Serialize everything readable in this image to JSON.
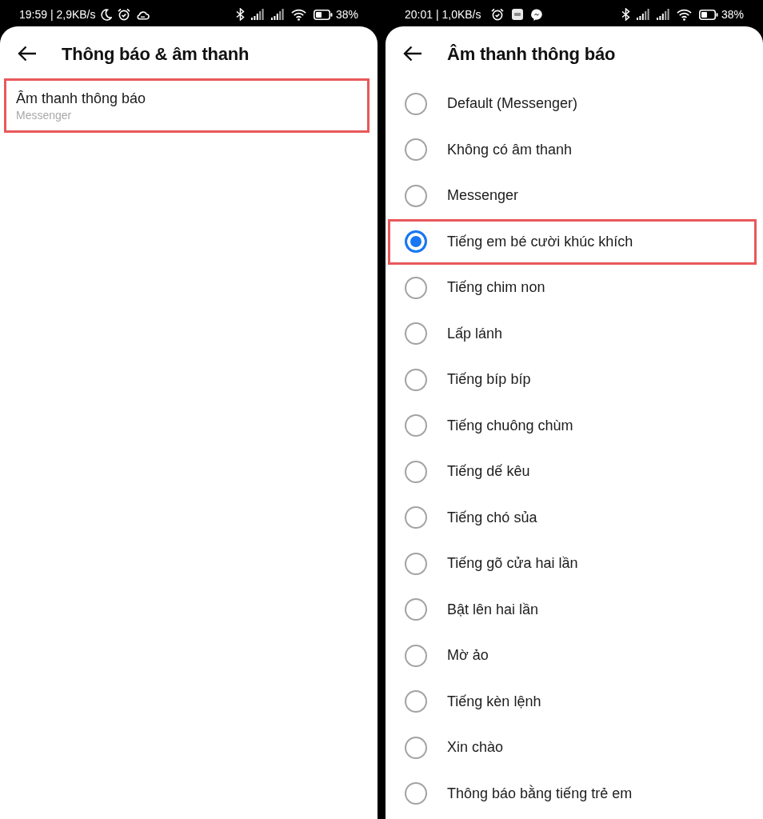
{
  "screens": [
    {
      "kind": "settings",
      "status_bar": {
        "text": "19:59 | 2,9KB/s",
        "icons": [
          {
            "kind": "moon"
          },
          {
            "kind": "alarm"
          },
          {
            "kind": "cloud"
          }
        ],
        "battery": "38%"
      },
      "header": {
        "title": "Thông báo & âm thanh"
      },
      "items": [
        {
          "title": "Âm thanh thông báo",
          "subtitle": "Messenger",
          "highlighted": true
        }
      ]
    },
    {
      "kind": "radio_list",
      "status_bar": {
        "text": "20:01 | 1,0KB/s",
        "icons": [
          {
            "kind": "alarm"
          },
          {
            "kind": "app_square"
          },
          {
            "kind": "messenger"
          }
        ],
        "battery": "38%"
      },
      "header": {
        "title": "Âm thanh thông báo"
      },
      "options": [
        {
          "label": "Default (Messenger)",
          "selected": false,
          "highlighted": false
        },
        {
          "label": "Không có âm thanh",
          "selected": false,
          "highlighted": false
        },
        {
          "label": "Messenger",
          "selected": false,
          "highlighted": false
        },
        {
          "label": "Tiếng em bé cười khúc khích",
          "selected": true,
          "highlighted": true
        },
        {
          "label": "Tiếng chim non",
          "selected": false,
          "highlighted": false
        },
        {
          "label": "Lấp lánh",
          "selected": false,
          "highlighted": false
        },
        {
          "label": "Tiếng bíp bíp",
          "selected": false,
          "highlighted": false
        },
        {
          "label": "Tiếng chuông chùm",
          "selected": false,
          "highlighted": false
        },
        {
          "label": "Tiếng dế kêu",
          "selected": false,
          "highlighted": false
        },
        {
          "label": "Tiếng chó sủa",
          "selected": false,
          "highlighted": false
        },
        {
          "label": "Tiếng gõ cửa hai lần",
          "selected": false,
          "highlighted": false
        },
        {
          "label": "Bật lên hai lần",
          "selected": false,
          "highlighted": false
        },
        {
          "label": "Mờ ảo",
          "selected": false,
          "highlighted": false
        },
        {
          "label": "Tiếng kèn lệnh",
          "selected": false,
          "highlighted": false
        },
        {
          "label": "Xin chào",
          "selected": false,
          "highlighted": false
        },
        {
          "label": "Thông báo bằng tiếng trẻ em",
          "selected": false,
          "highlighted": false
        }
      ]
    }
  ]
}
